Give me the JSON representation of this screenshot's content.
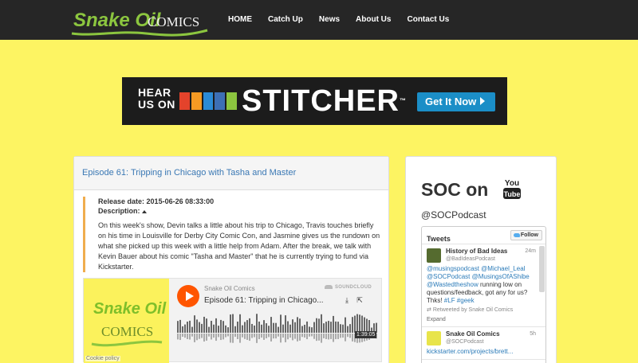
{
  "brand": {
    "name_part1": "Snake Oil",
    "name_part2": "COMICS"
  },
  "nav": [
    "HOME",
    "Catch Up",
    "News",
    "About Us",
    "Contact Us"
  ],
  "banner": {
    "hear": "HEAR",
    "us_on": "US ON",
    "word": "STITCHER",
    "tm": "™",
    "cta": "Get It Now",
    "bar_colors": [
      "#e4432b",
      "#f59a23",
      "#2b8bd6",
      "#3d6fb5",
      "#8cc53f"
    ]
  },
  "episode": {
    "title": "Episode 61: Tripping in Chicago with Tasha and Master",
    "release_label": "Release date:",
    "release_value": "2015-06-26 08:33:00",
    "description_label": "Description:",
    "description": "On this week's show, Devin talks a little about his trip to Chicago, Travis touches briefly on his time in Louisville for Derby City Comic Con, and Jasmine gives us the rundown on what she picked up this week with a little help from Adam. After the break, we talk with Kevin Bauer about his comic \"Tasha and Master\" that he is currently trying to fund via Kickstarter."
  },
  "player": {
    "artwork_line1": "Snake Oil",
    "artwork_line2": "COMICS",
    "cookie": "Cookie policy",
    "user": "Snake Oil Comics",
    "brand": "SOUNDCLOUD",
    "title": "Episode 61: Tripping in Chicago...",
    "duration": "1:39:05",
    "progress": 0,
    "accent": "#ff5500"
  },
  "sidebar": {
    "soc_on": "SOC on",
    "youtube_top": "You",
    "youtube_bottom": "Tube",
    "handle": "@SOCPodcast"
  },
  "twitter": {
    "heading": "Tweets",
    "follow": "Follow",
    "tweets": [
      {
        "name": "History of Bad Ideas",
        "handle": "@BadIdeasPodcast",
        "time": "24m",
        "mentions": "@musingspodcast @Michael_Leal @SOCPodcast @MusingsOfAShibe @Wastedtheshow",
        "text": "running low on questions/feedback, got any for us? Thks!",
        "tags": "#LF #geek",
        "retweet": "Retweeted by Snake Oil Comics",
        "expand": "Expand"
      },
      {
        "name": "Snake Oil Comics",
        "handle": "@SOCPodcast",
        "time": "5h",
        "text": "kickstarter.com/projects/brett..."
      }
    ]
  }
}
